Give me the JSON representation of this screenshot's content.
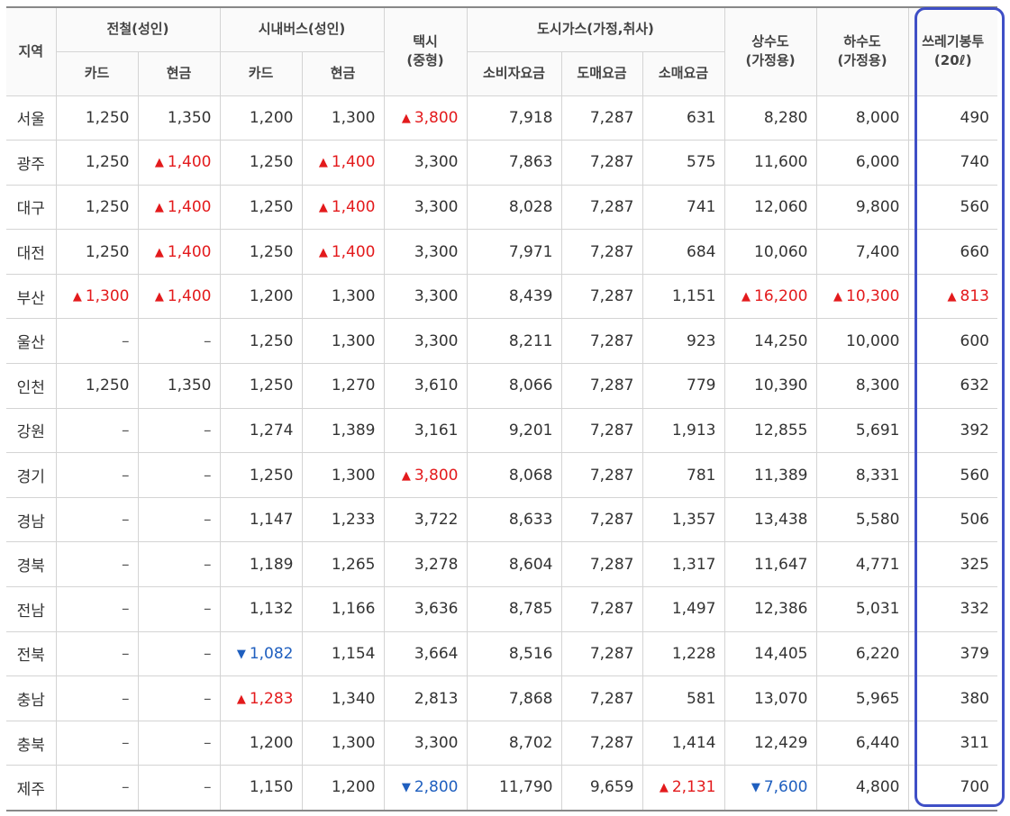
{
  "headers": {
    "region": "지역",
    "subway": "전철(성인)",
    "bus": "시내버스(성인)",
    "taxi_l1": "택시",
    "taxi_l2": "(중형)",
    "gas": "도시가스(가정,취사)",
    "water_l1": "상수도",
    "water_l2": "(가정용)",
    "sewer_l1": "하수도",
    "sewer_l2": "(가정용)",
    "trash_l1": "쓰레기봉투",
    "trash_l2": "(20ℓ)",
    "card": "카드",
    "cash": "현금",
    "consumer": "소비자요금",
    "wholesale": "도매요금",
    "retail": "소매요금"
  },
  "arrows": {
    "up": "▲",
    "down": "▼"
  },
  "colors": {
    "up": "#e31a1c",
    "down": "#1f5fbf",
    "highlight_border": "#3f4fc6"
  },
  "rows": [
    [
      "서울",
      "1,250",
      "1,350",
      "1,200",
      "1,300",
      "3,800",
      "7,918",
      "7,287",
      "631",
      "8,280",
      "8,000",
      "490"
    ],
    [
      "광주",
      "1,250",
      "1,400",
      "1,250",
      "1,400",
      "3,300",
      "7,863",
      "7,287",
      "575",
      "11,600",
      "6,000",
      "740"
    ],
    [
      "대구",
      "1,250",
      "1,400",
      "1,250",
      "1,400",
      "3,300",
      "8,028",
      "7,287",
      "741",
      "12,060",
      "9,800",
      "560"
    ],
    [
      "대전",
      "1,250",
      "1,400",
      "1,250",
      "1,400",
      "3,300",
      "7,971",
      "7,287",
      "684",
      "10,060",
      "7,400",
      "660"
    ],
    [
      "부산",
      "1,300",
      "1,400",
      "1,200",
      "1,300",
      "3,300",
      "8,439",
      "7,287",
      "1,151",
      "16,200",
      "10,300",
      "813"
    ],
    [
      "울산",
      "–",
      "–",
      "1,250",
      "1,300",
      "3,300",
      "8,211",
      "7,287",
      "923",
      "14,250",
      "10,000",
      "600"
    ],
    [
      "인천",
      "1,250",
      "1,350",
      "1,250",
      "1,270",
      "3,610",
      "8,066",
      "7,287",
      "779",
      "10,390",
      "8,300",
      "632"
    ],
    [
      "강원",
      "–",
      "–",
      "1,274",
      "1,389",
      "3,161",
      "9,201",
      "7,287",
      "1,913",
      "12,855",
      "5,691",
      "392"
    ],
    [
      "경기",
      "–",
      "–",
      "1,250",
      "1,300",
      "3,800",
      "8,068",
      "7,287",
      "781",
      "11,389",
      "8,331",
      "560"
    ],
    [
      "경남",
      "–",
      "–",
      "1,147",
      "1,233",
      "3,722",
      "8,633",
      "7,287",
      "1,357",
      "13,438",
      "5,580",
      "506"
    ],
    [
      "경북",
      "–",
      "–",
      "1,189",
      "1,265",
      "3,278",
      "8,604",
      "7,287",
      "1,317",
      "11,647",
      "4,771",
      "325"
    ],
    [
      "전남",
      "–",
      "–",
      "1,132",
      "1,166",
      "3,636",
      "8,785",
      "7,287",
      "1,497",
      "12,386",
      "5,031",
      "332"
    ],
    [
      "전북",
      "–",
      "–",
      "1,082",
      "1,154",
      "3,664",
      "8,516",
      "7,287",
      "1,228",
      "14,405",
      "6,220",
      "379"
    ],
    [
      "충남",
      "–",
      "–",
      "1,283",
      "1,340",
      "2,813",
      "7,868",
      "7,287",
      "581",
      "13,070",
      "5,965",
      "380"
    ],
    [
      "충북",
      "–",
      "–",
      "1,200",
      "1,300",
      "3,300",
      "8,702",
      "7,287",
      "1,414",
      "12,429",
      "6,440",
      "311"
    ],
    [
      "제주",
      "–",
      "–",
      "1,150",
      "1,200",
      "2,800",
      "11,790",
      "9,659",
      "2,131",
      "7,600",
      "4,800",
      "700"
    ]
  ],
  "changes": [
    {
      "row": 0,
      "col": 5,
      "dir": "up"
    },
    {
      "row": 1,
      "col": 2,
      "dir": "up"
    },
    {
      "row": 1,
      "col": 4,
      "dir": "up"
    },
    {
      "row": 2,
      "col": 2,
      "dir": "up"
    },
    {
      "row": 2,
      "col": 4,
      "dir": "up"
    },
    {
      "row": 3,
      "col": 2,
      "dir": "up"
    },
    {
      "row": 3,
      "col": 4,
      "dir": "up"
    },
    {
      "row": 4,
      "col": 1,
      "dir": "up"
    },
    {
      "row": 4,
      "col": 2,
      "dir": "up"
    },
    {
      "row": 4,
      "col": 9,
      "dir": "up"
    },
    {
      "row": 4,
      "col": 10,
      "dir": "up"
    },
    {
      "row": 4,
      "col": 11,
      "dir": "up"
    },
    {
      "row": 8,
      "col": 5,
      "dir": "up"
    },
    {
      "row": 12,
      "col": 3,
      "dir": "down"
    },
    {
      "row": 13,
      "col": 3,
      "dir": "up"
    },
    {
      "row": 15,
      "col": 5,
      "dir": "down"
    },
    {
      "row": 15,
      "col": 8,
      "dir": "up"
    },
    {
      "row": 15,
      "col": 9,
      "dir": "down"
    }
  ]
}
